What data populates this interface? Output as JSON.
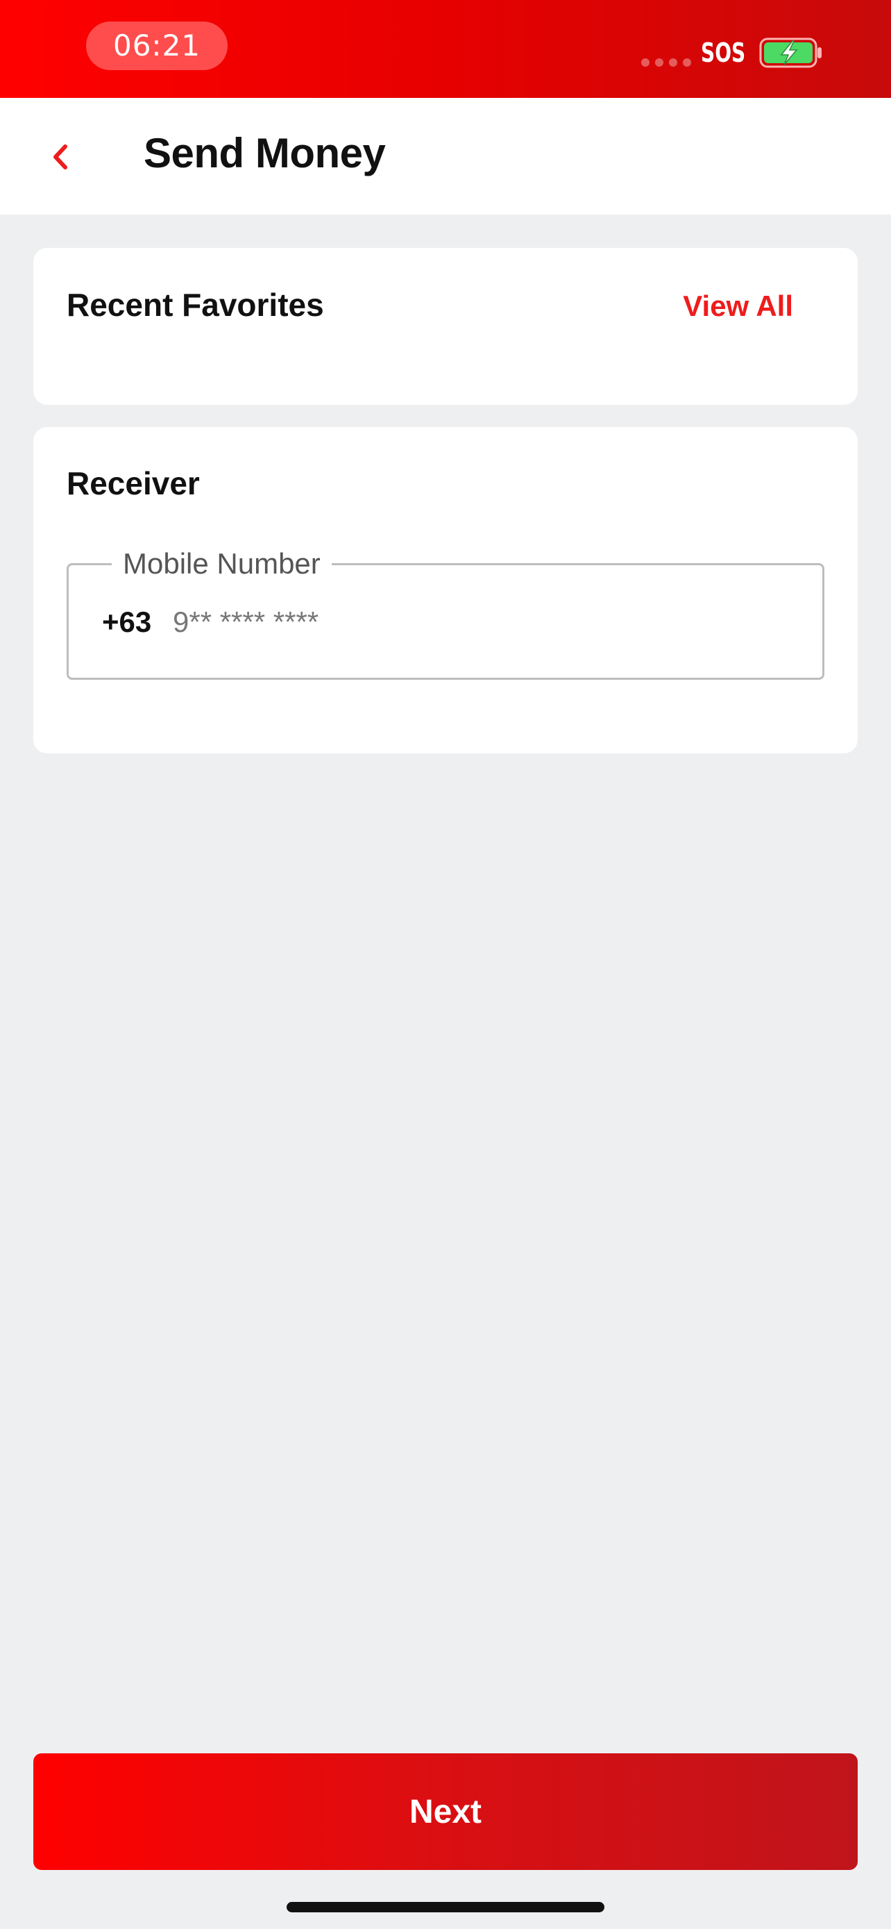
{
  "status_bar": {
    "time": "06:21",
    "carrier_status": "SOS",
    "battery_icon": "battery-charging-icon",
    "colors": {
      "background": "#e60000",
      "battery_fill": "#4cd964"
    }
  },
  "header": {
    "back_icon": "chevron-left-icon",
    "title": "Send Money"
  },
  "favorites": {
    "title": "Recent Favorites",
    "view_all_label": "View All"
  },
  "receiver": {
    "title": "Receiver",
    "mobile_field": {
      "label": "Mobile Number",
      "country_code": "+63",
      "placeholder": "9** **** ****",
      "value": ""
    }
  },
  "actions": {
    "next_label": "Next"
  },
  "colors": {
    "accent": "#ee1c1c",
    "page_background": "#eeeff1",
    "card_background": "#ffffff"
  }
}
